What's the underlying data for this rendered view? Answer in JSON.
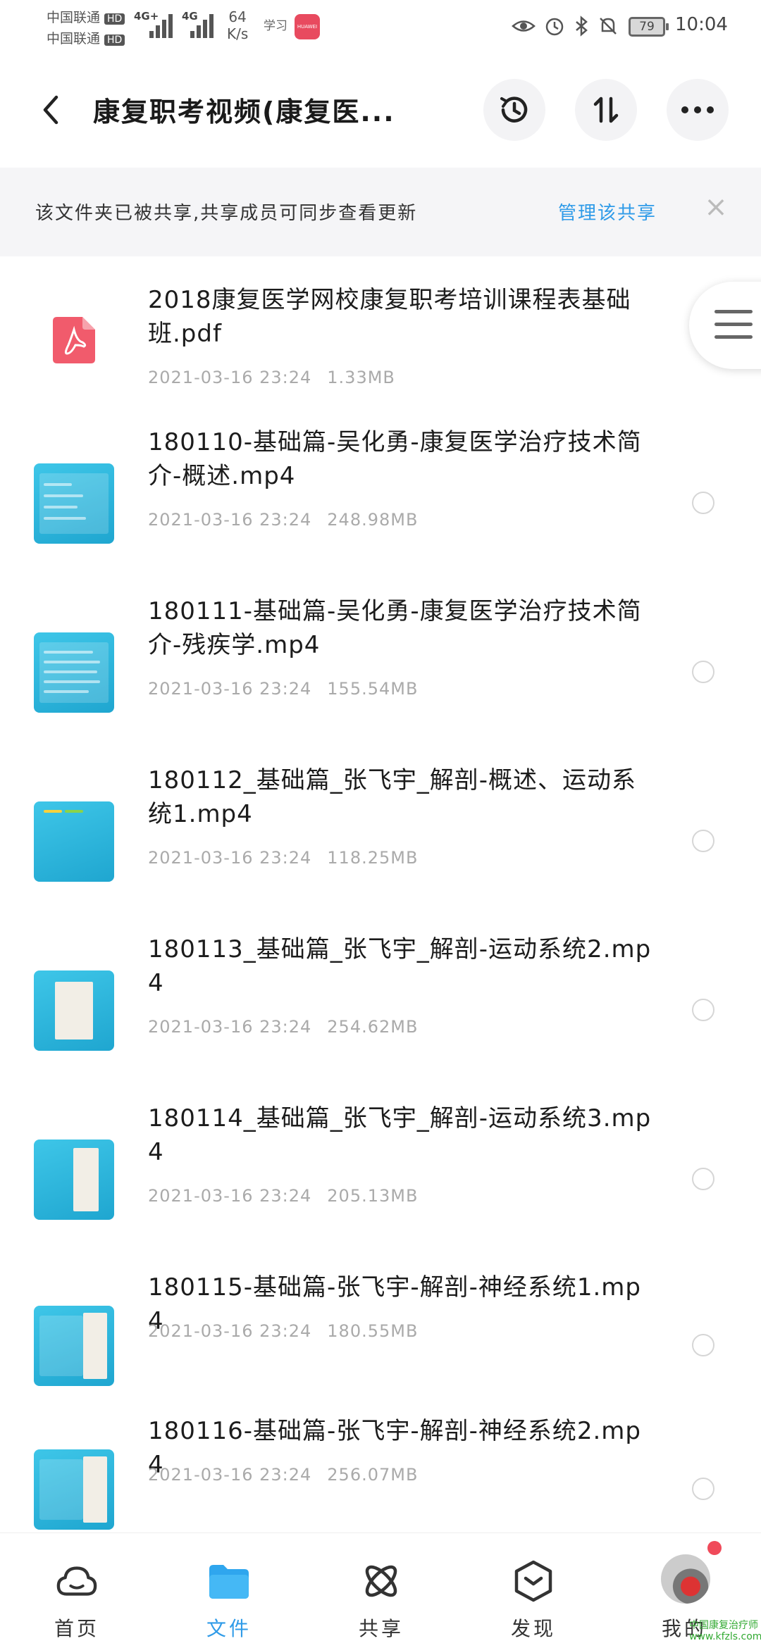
{
  "status_bar": {
    "carrier1": "中国联通",
    "carrier2": "中国联通",
    "hd": "HD",
    "net1": "4G+",
    "net2": "4G",
    "speed_value": "64",
    "speed_unit": "K/s",
    "app_note": "学习",
    "huawei_badge": "HUAWEI",
    "battery": "79",
    "time": "10:04"
  },
  "header": {
    "title": "康复职考视频(康复医..."
  },
  "banner": {
    "text": "该文件夹已被共享,共享成员可同步查看更新",
    "manage_link": "管理该共享",
    "close_glyph": "×"
  },
  "files": [
    {
      "name": "2018康复医学网校康复职考培训课程表基础班.pdf",
      "date": "2021-03-16  23:24",
      "size": "1.33MB",
      "type": "pdf-icon"
    },
    {
      "name": "180110-基础篇-吴化勇-康复医学治疗技术简介-概述.mp4",
      "date": "2021-03-16  23:24",
      "size": "248.98MB",
      "type": "video"
    },
    {
      "name": "180111-基础篇-吴化勇-康复医学治疗技术简介-残疾学.mp4",
      "date": "2021-03-16  23:24",
      "size": "155.54MB",
      "type": "video"
    },
    {
      "name": "180112_基础篇_张飞宇_解剖-概述、运动系统1.mp4",
      "date": "2021-03-16  23:24",
      "size": "118.25MB",
      "type": "video"
    },
    {
      "name": "180113_基础篇_张飞宇_解剖-运动系统2.mp4",
      "date": "2021-03-16  23:24",
      "size": "254.62MB",
      "type": "video"
    },
    {
      "name": "180114_基础篇_张飞宇_解剖-运动系统3.mp4",
      "date": "2021-03-16  23:24",
      "size": "205.13MB",
      "type": "video"
    },
    {
      "name": "180115-基础篇-张飞宇-解剖-神经系统1.mp4",
      "date": "2021-03-16  23:24",
      "size": "180.55MB",
      "type": "video"
    },
    {
      "name": "180116-基础篇-张飞宇-解剖-神经系统2.mp4",
      "date": "2021-03-16  23:24",
      "size": "256.07MB",
      "type": "video"
    }
  ],
  "bottom_nav": [
    {
      "label": "首页",
      "icon": "cloud-icon",
      "active": false
    },
    {
      "label": "文件",
      "icon": "folder-icon",
      "active": true
    },
    {
      "label": "共享",
      "icon": "share-atom-icon",
      "active": false
    },
    {
      "label": "发现",
      "icon": "discover-box-icon",
      "active": false
    },
    {
      "label": "我的",
      "icon": "avatar",
      "active": false
    }
  ],
  "watermark": "中国康复治疗师 www.kfzls.com",
  "colors": {
    "accent": "#2f9be8",
    "pdf_red": "#f15b6c",
    "thumb_blue": "#2bb5de"
  }
}
